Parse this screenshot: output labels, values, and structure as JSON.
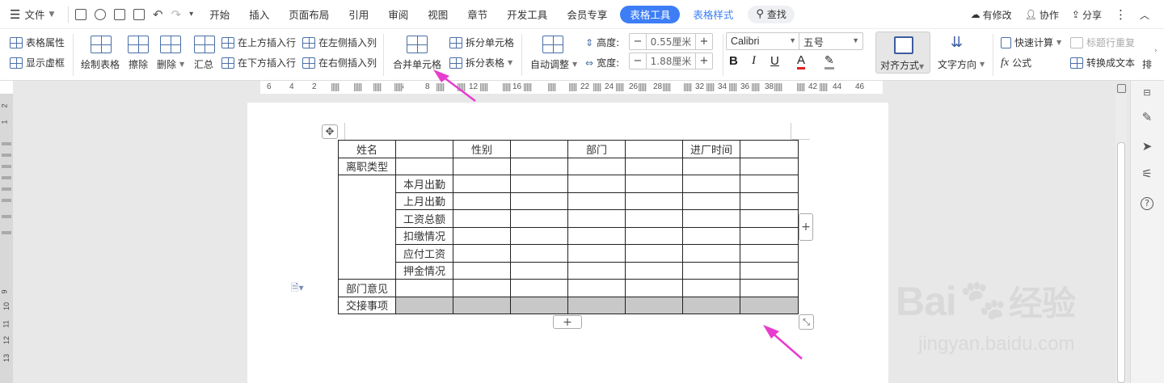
{
  "menubar": {
    "file_label": "文件",
    "tabs": [
      "开始",
      "插入",
      "页面布局",
      "引用",
      "审阅",
      "视图",
      "章节",
      "开发工具",
      "会员专享"
    ],
    "active_tab": "表格工具",
    "accent_tab": "表格样式",
    "search_label": "查找",
    "right": {
      "modified": "有修改",
      "collab": "协作",
      "share": "分享"
    }
  },
  "ribbon": {
    "table_props": "表格属性",
    "show_gridlines": "显示虚框",
    "draw_table": "绘制表格",
    "erase": "擦除",
    "delete": "删除",
    "summary": "汇总",
    "insert_above": "在上方插入行",
    "insert_below": "在下方插入行",
    "insert_left": "在左侧插入列",
    "insert_right": "在右侧插入列",
    "merge_cells": "合并单元格",
    "split_cells": "拆分单元格",
    "split_table": "拆分表格",
    "auto_fit": "自动调整",
    "height_label": "高度:",
    "height_value": "0.55厘米",
    "width_label": "宽度:",
    "width_value": "1.88厘米",
    "font_name": "Calibri",
    "font_size": "五号",
    "align": "对齐方式",
    "text_dir": "文字方向",
    "quick_calc": "快速计算",
    "repeat_header": "标题行重复",
    "formula": "公式",
    "to_text": "转换成文本",
    "sort_short": "排"
  },
  "ruler": {
    "labels": [
      "6",
      "4",
      "2",
      "6",
      "8",
      "12",
      "16",
      "22",
      "24",
      "26",
      "28",
      "32",
      "34",
      "36",
      "38",
      "42",
      "44",
      "46"
    ]
  },
  "vruler": {
    "labels": [
      "2",
      "1",
      "9",
      "10",
      "11",
      "12",
      "13"
    ]
  },
  "table": {
    "header": [
      "姓名",
      "",
      "性别",
      "",
      "部门",
      "",
      "进厂时间",
      ""
    ],
    "row_leave": "离职类型",
    "sub_rows": [
      "本月出勤",
      "上月出勤",
      "工资总额",
      "扣缴情况",
      "应付工资",
      "押金情况"
    ],
    "row_opinion": "部门意见",
    "row_handover": "交接事项"
  },
  "watermark": {
    "brand": "Bai",
    "brand2": "经验",
    "url": "jingyan.baidu.com"
  },
  "colors": {
    "accent": "#3d7ef6",
    "arrow": "#e83ccf",
    "selection": "#c8c8c8"
  }
}
